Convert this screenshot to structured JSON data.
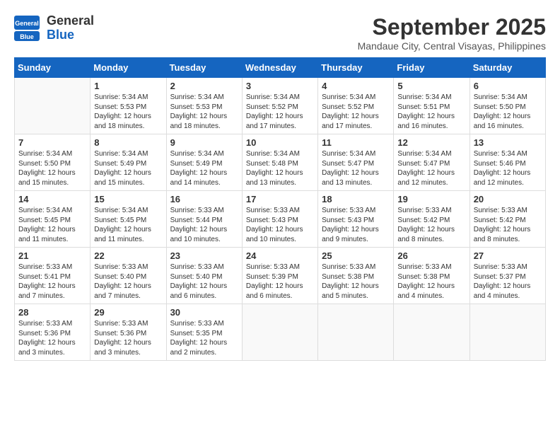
{
  "logo": {
    "line1": "General",
    "line2": "Blue"
  },
  "title": {
    "month_year": "September 2025",
    "location": "Mandaue City, Central Visayas, Philippines"
  },
  "weekdays": [
    "Sunday",
    "Monday",
    "Tuesday",
    "Wednesday",
    "Thursday",
    "Friday",
    "Saturday"
  ],
  "weeks": [
    [
      {
        "day": "",
        "info": ""
      },
      {
        "day": "1",
        "info": "Sunrise: 5:34 AM\nSunset: 5:53 PM\nDaylight: 12 hours\nand 18 minutes."
      },
      {
        "day": "2",
        "info": "Sunrise: 5:34 AM\nSunset: 5:53 PM\nDaylight: 12 hours\nand 18 minutes."
      },
      {
        "day": "3",
        "info": "Sunrise: 5:34 AM\nSunset: 5:52 PM\nDaylight: 12 hours\nand 17 minutes."
      },
      {
        "day": "4",
        "info": "Sunrise: 5:34 AM\nSunset: 5:52 PM\nDaylight: 12 hours\nand 17 minutes."
      },
      {
        "day": "5",
        "info": "Sunrise: 5:34 AM\nSunset: 5:51 PM\nDaylight: 12 hours\nand 16 minutes."
      },
      {
        "day": "6",
        "info": "Sunrise: 5:34 AM\nSunset: 5:50 PM\nDaylight: 12 hours\nand 16 minutes."
      }
    ],
    [
      {
        "day": "7",
        "info": "Sunrise: 5:34 AM\nSunset: 5:50 PM\nDaylight: 12 hours\nand 15 minutes."
      },
      {
        "day": "8",
        "info": "Sunrise: 5:34 AM\nSunset: 5:49 PM\nDaylight: 12 hours\nand 15 minutes."
      },
      {
        "day": "9",
        "info": "Sunrise: 5:34 AM\nSunset: 5:49 PM\nDaylight: 12 hours\nand 14 minutes."
      },
      {
        "day": "10",
        "info": "Sunrise: 5:34 AM\nSunset: 5:48 PM\nDaylight: 12 hours\nand 13 minutes."
      },
      {
        "day": "11",
        "info": "Sunrise: 5:34 AM\nSunset: 5:47 PM\nDaylight: 12 hours\nand 13 minutes."
      },
      {
        "day": "12",
        "info": "Sunrise: 5:34 AM\nSunset: 5:47 PM\nDaylight: 12 hours\nand 12 minutes."
      },
      {
        "day": "13",
        "info": "Sunrise: 5:34 AM\nSunset: 5:46 PM\nDaylight: 12 hours\nand 12 minutes."
      }
    ],
    [
      {
        "day": "14",
        "info": "Sunrise: 5:34 AM\nSunset: 5:45 PM\nDaylight: 12 hours\nand 11 minutes."
      },
      {
        "day": "15",
        "info": "Sunrise: 5:34 AM\nSunset: 5:45 PM\nDaylight: 12 hours\nand 11 minutes."
      },
      {
        "day": "16",
        "info": "Sunrise: 5:33 AM\nSunset: 5:44 PM\nDaylight: 12 hours\nand 10 minutes."
      },
      {
        "day": "17",
        "info": "Sunrise: 5:33 AM\nSunset: 5:43 PM\nDaylight: 12 hours\nand 10 minutes."
      },
      {
        "day": "18",
        "info": "Sunrise: 5:33 AM\nSunset: 5:43 PM\nDaylight: 12 hours\nand 9 minutes."
      },
      {
        "day": "19",
        "info": "Sunrise: 5:33 AM\nSunset: 5:42 PM\nDaylight: 12 hours\nand 8 minutes."
      },
      {
        "day": "20",
        "info": "Sunrise: 5:33 AM\nSunset: 5:42 PM\nDaylight: 12 hours\nand 8 minutes."
      }
    ],
    [
      {
        "day": "21",
        "info": "Sunrise: 5:33 AM\nSunset: 5:41 PM\nDaylight: 12 hours\nand 7 minutes."
      },
      {
        "day": "22",
        "info": "Sunrise: 5:33 AM\nSunset: 5:40 PM\nDaylight: 12 hours\nand 7 minutes."
      },
      {
        "day": "23",
        "info": "Sunrise: 5:33 AM\nSunset: 5:40 PM\nDaylight: 12 hours\nand 6 minutes."
      },
      {
        "day": "24",
        "info": "Sunrise: 5:33 AM\nSunset: 5:39 PM\nDaylight: 12 hours\nand 6 minutes."
      },
      {
        "day": "25",
        "info": "Sunrise: 5:33 AM\nSunset: 5:38 PM\nDaylight: 12 hours\nand 5 minutes."
      },
      {
        "day": "26",
        "info": "Sunrise: 5:33 AM\nSunset: 5:38 PM\nDaylight: 12 hours\nand 4 minutes."
      },
      {
        "day": "27",
        "info": "Sunrise: 5:33 AM\nSunset: 5:37 PM\nDaylight: 12 hours\nand 4 minutes."
      }
    ],
    [
      {
        "day": "28",
        "info": "Sunrise: 5:33 AM\nSunset: 5:36 PM\nDaylight: 12 hours\nand 3 minutes."
      },
      {
        "day": "29",
        "info": "Sunrise: 5:33 AM\nSunset: 5:36 PM\nDaylight: 12 hours\nand 3 minutes."
      },
      {
        "day": "30",
        "info": "Sunrise: 5:33 AM\nSunset: 5:35 PM\nDaylight: 12 hours\nand 2 minutes."
      },
      {
        "day": "",
        "info": ""
      },
      {
        "day": "",
        "info": ""
      },
      {
        "day": "",
        "info": ""
      },
      {
        "day": "",
        "info": ""
      }
    ]
  ]
}
